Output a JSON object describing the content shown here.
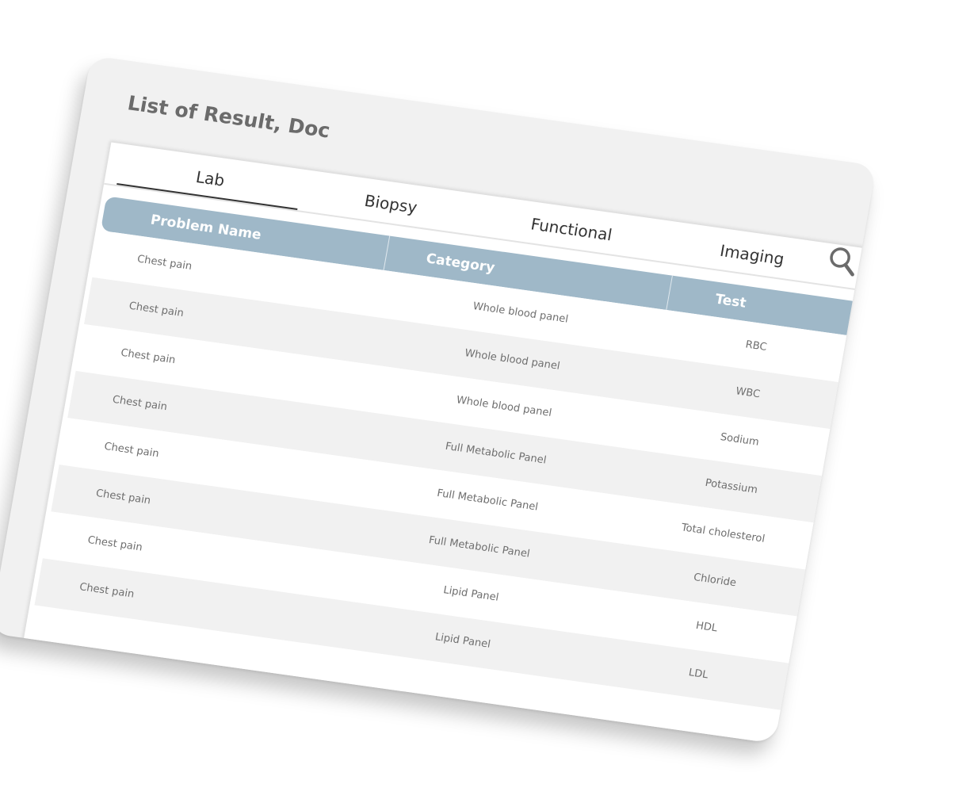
{
  "title": "List of Result, Doc",
  "tabs": [
    {
      "label": "Lab",
      "active": true
    },
    {
      "label": "Biopsy",
      "active": false
    },
    {
      "label": "Functional",
      "active": false
    },
    {
      "label": "Imaging",
      "active": false
    }
  ],
  "search": {
    "icon": "search-icon"
  },
  "table": {
    "columns": [
      "Problem Name",
      "Category",
      "Test"
    ],
    "rows": [
      [
        "Chest pain",
        "Whole blood panel",
        "RBC"
      ],
      [
        "Chest pain",
        "Whole blood panel",
        "WBC"
      ],
      [
        "Chest pain",
        "Whole blood panel",
        "Sodium"
      ],
      [
        "Chest pain",
        "Full Metabolic Panel",
        "Potassium"
      ],
      [
        "Chest pain",
        "Full Metabolic Panel",
        "Total cholesterol"
      ],
      [
        "Chest pain",
        "Full Metabolic Panel",
        "Chloride"
      ],
      [
        "Chest pain",
        "Lipid Panel",
        "HDL"
      ],
      [
        "Chest pain",
        "Lipid Panel",
        "LDL"
      ]
    ]
  },
  "colors": {
    "header_bg": "#9fb8c8",
    "card_bg": "#f1f1f1",
    "text": "#6e6e6e"
  }
}
